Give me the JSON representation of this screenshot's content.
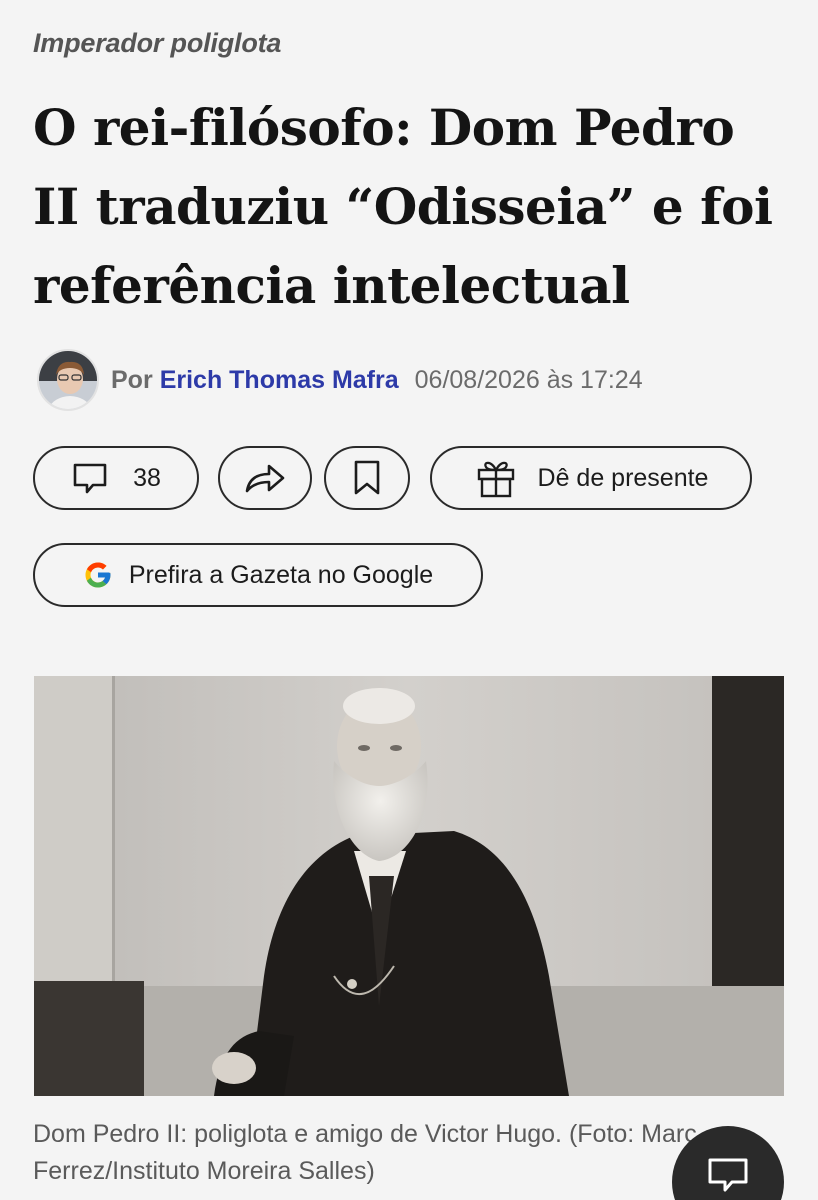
{
  "article": {
    "kicker": "Imperador poliglota",
    "headline": "O rei-filósofo: Dom Pedro II traduziu “Odisseia” e foi referência intelectual",
    "byline_prefix": "Por",
    "author": "Erich Thomas Mafra",
    "date": "06/08/2026 às 17:24"
  },
  "actions": {
    "comments_count": "38",
    "gift_label": "Dê de presente",
    "google_label": "Prefira a Gazeta no Google"
  },
  "image": {
    "caption": "Dom Pedro II: poliglota e amigo de Victor Hugo. (Foto: Marc Ferrez/Instituto Moreira Salles)"
  },
  "icons": {
    "comment": "comment-icon",
    "share": "share-icon",
    "bookmark": "bookmark-icon",
    "gift": "gift-icon",
    "google": "google-icon",
    "fab": "comment-icon"
  },
  "colors": {
    "background": "#f4f4f4",
    "author_link": "#2d3aa8",
    "text": "#141414",
    "muted": "#6b6b6b"
  }
}
